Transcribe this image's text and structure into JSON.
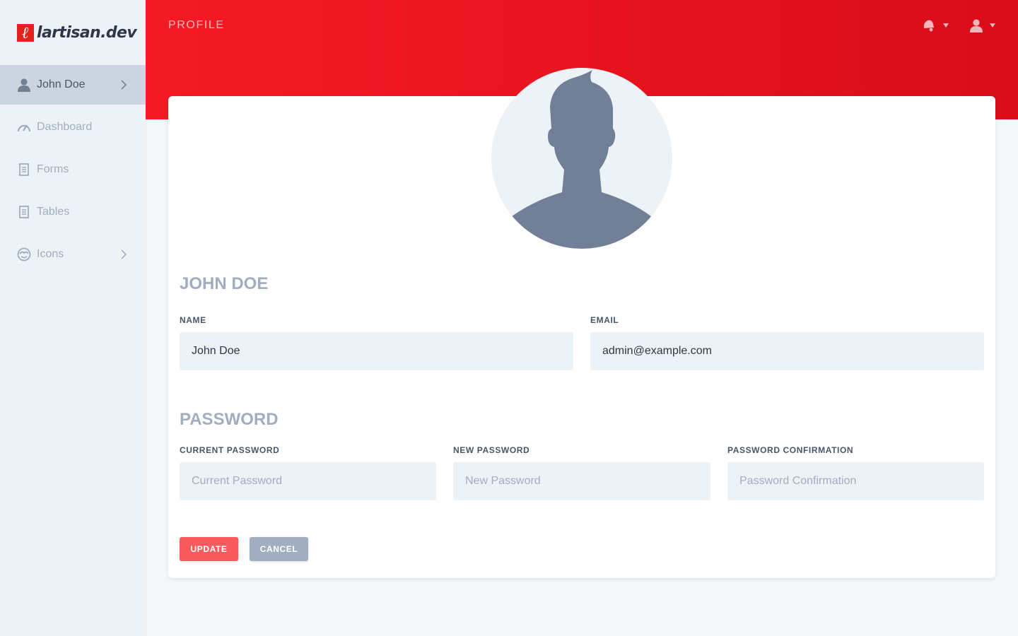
{
  "brand": {
    "mark": "ℓ",
    "name": "lartisan.dev",
    "accent": "#e3211f"
  },
  "sidebar": {
    "items": [
      {
        "label": "John Doe",
        "icon": "user-icon",
        "active": true,
        "has_children": true
      },
      {
        "label": "Dashboard",
        "icon": "speedometer-icon",
        "active": false,
        "has_children": false
      },
      {
        "label": "Forms",
        "icon": "document-icon",
        "active": false,
        "has_children": false
      },
      {
        "label": "Tables",
        "icon": "document-icon",
        "active": false,
        "has_children": false
      },
      {
        "label": "Icons",
        "icon": "emoji-icon",
        "active": false,
        "has_children": true
      }
    ]
  },
  "header": {
    "title": "PROFILE",
    "actions": [
      {
        "icon": "notification-bell-icon"
      },
      {
        "icon": "user-icon"
      }
    ],
    "gradient": [
      "#f51a24",
      "#d90d1a"
    ]
  },
  "profile": {
    "name_heading": "JOHN DOE",
    "name_label": "NAME",
    "name_value": "John Doe",
    "email_label": "EMAIL",
    "email_value": "admin@example.com"
  },
  "password": {
    "heading": "PASSWORD",
    "current_label": "CURRENT PASSWORD",
    "current_placeholder": "Current Password",
    "new_label": "NEW PASSWORD",
    "new_placeholder": "New Password",
    "confirm_label": "PASSWORD CONFIRMATION",
    "confirm_placeholder": "Password Confirmation"
  },
  "actions": {
    "update_label": "UPDATE",
    "cancel_label": "CANCEL",
    "update_color": "#f85a5d",
    "cancel_color": "#a0aec0"
  }
}
